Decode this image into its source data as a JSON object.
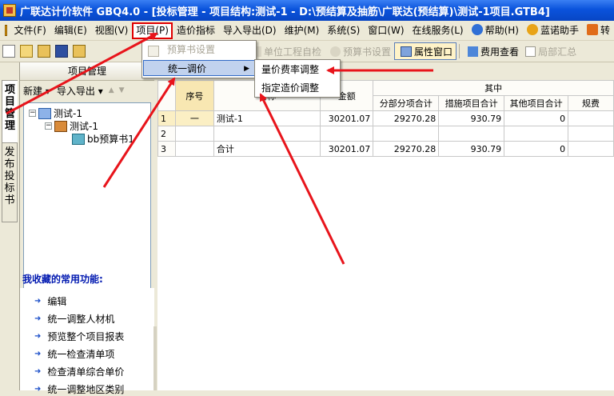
{
  "window": {
    "title": "广联达计价软件 GBQ4.0 - [投标管理 - 项目结构:测试-1 - D:\\预结算及抽筋\\广联达(预结算)\\测试-1项目.GTB4]"
  },
  "menubar": {
    "items": [
      {
        "key": "file",
        "label": "文件(F)"
      },
      {
        "key": "edit",
        "label": "编辑(E)"
      },
      {
        "key": "view",
        "label": "视图(V)"
      },
      {
        "key": "project",
        "label": "项目(P)"
      },
      {
        "key": "cost",
        "label": "造价指标"
      },
      {
        "key": "io",
        "label": "导入导出(D)"
      },
      {
        "key": "maintain",
        "label": "维护(M)"
      },
      {
        "key": "system",
        "label": "系统(S)"
      },
      {
        "key": "window",
        "label": "窗口(W)"
      },
      {
        "key": "online",
        "label": "在线服务(L)"
      },
      {
        "key": "help",
        "label": "帮助(H)"
      },
      {
        "key": "blue",
        "label": "蓝诺助手"
      },
      {
        "key": "more",
        "label": "转"
      }
    ]
  },
  "toolbar": {
    "unit_check": "单位工程自检",
    "budget_settings": "预算书设置",
    "property_window": "属性窗口",
    "fee_view": "费用查看",
    "partial_summary": "局部汇总"
  },
  "vtabs": {
    "project_mgmt": "项目管理",
    "publish_bid": "发布投标书"
  },
  "left_panel": {
    "title": "项目管理",
    "new_label": "新建",
    "io_label": "导入导出",
    "tree": [
      {
        "label": "测试-1",
        "level": 0
      },
      {
        "label": "测试-1",
        "level": 1
      },
      {
        "label": "bb预算书1",
        "level": 2
      }
    ],
    "favorites_title": "我收藏的常用功能:",
    "favorites": [
      "编辑",
      "统一调整人材机",
      "预览整个项目报表",
      "统一检查清单项",
      "检查清单综合单价",
      "统一调整地区类别"
    ]
  },
  "grid": {
    "headers": {
      "seq": "序号",
      "name": "名称",
      "amount": "金额",
      "among": "其中",
      "sub_total": "分部分项合计",
      "measure_total": "措施项目合计",
      "other_total": "其他项目合计",
      "fee": "规费"
    },
    "rows": [
      {
        "rn": "1",
        "seq": "一",
        "name": "测试-1",
        "amount": "30201.07",
        "sub": "29270.28",
        "measure": "930.79",
        "other": "0",
        "fee": ""
      },
      {
        "rn": "2",
        "seq": "",
        "name": "",
        "amount": "",
        "sub": "",
        "measure": "",
        "other": "",
        "fee": ""
      },
      {
        "rn": "3",
        "seq": "",
        "name": "合计",
        "amount": "30201.07",
        "sub": "29270.28",
        "measure": "930.79",
        "other": "0",
        "fee": ""
      }
    ]
  },
  "project_menu": {
    "items": [
      "预算书设置",
      "统一调价"
    ]
  },
  "submenu": {
    "items": [
      "量价费率调整",
      "指定造价调整"
    ]
  },
  "annotation": {
    "arrow_color": "#E8141B"
  }
}
